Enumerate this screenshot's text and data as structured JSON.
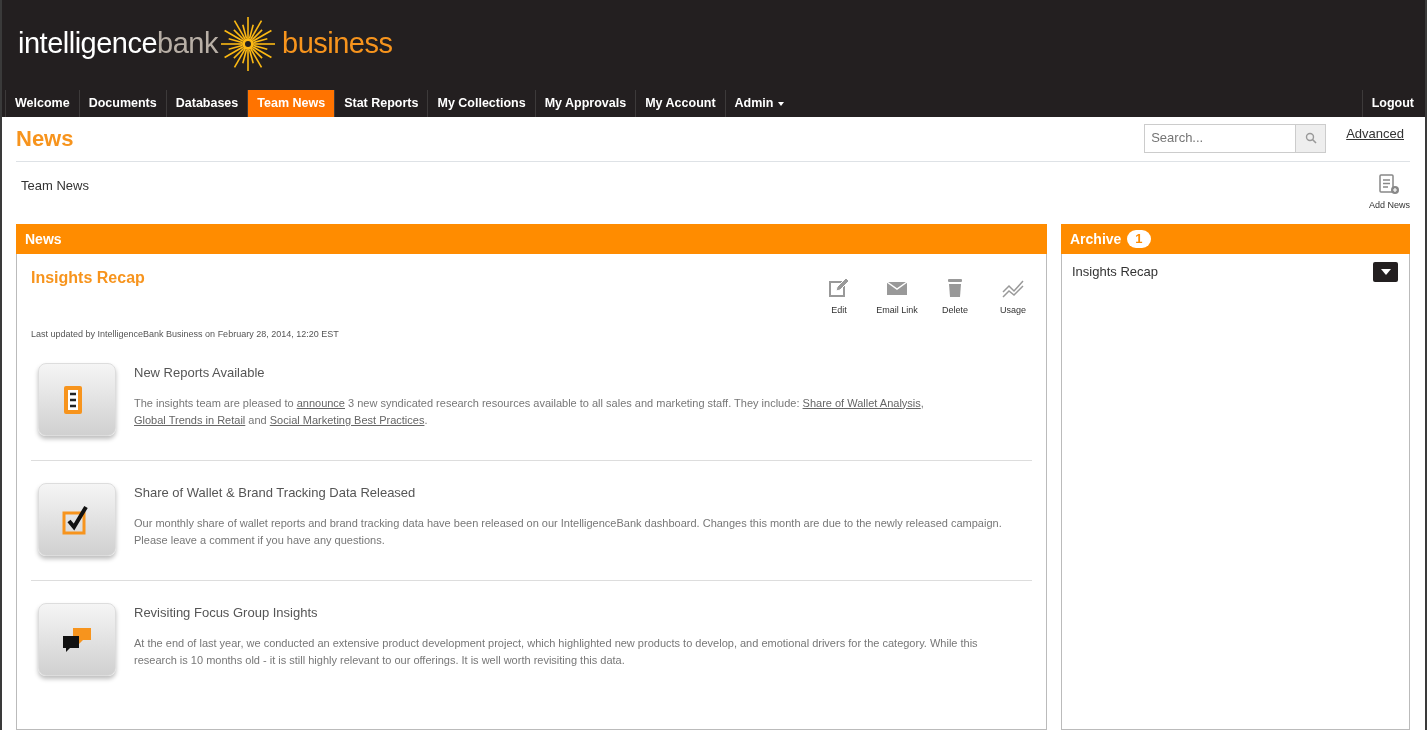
{
  "logo": {
    "part_1": "intelligence",
    "part_2": "bank",
    "part_3": "business"
  },
  "nav": {
    "tabs": [
      {
        "label": "Welcome",
        "selected": false,
        "dropdown": false
      },
      {
        "label": "Documents",
        "selected": false,
        "dropdown": false
      },
      {
        "label": "Databases",
        "selected": false,
        "dropdown": false
      },
      {
        "label": "Team News",
        "selected": true,
        "dropdown": false
      },
      {
        "label": "Stat Reports",
        "selected": false,
        "dropdown": false
      },
      {
        "label": "My Collections",
        "selected": false,
        "dropdown": false
      },
      {
        "label": "My Approvals",
        "selected": false,
        "dropdown": false
      },
      {
        "label": "My Account",
        "selected": false,
        "dropdown": false
      },
      {
        "label": "Admin",
        "selected": false,
        "dropdown": true
      }
    ],
    "logout": "Logout"
  },
  "page": {
    "title": "News",
    "search": {
      "placeholder": "Search..."
    },
    "advanced": "Advanced",
    "breadcrumb": "Team News",
    "add_button": "Add News"
  },
  "news_panel": {
    "header": "News",
    "title": "Insights Recap",
    "actions": [
      {
        "kind": "edit",
        "label": "Edit"
      },
      {
        "kind": "email",
        "label": "Email Link"
      },
      {
        "kind": "delete",
        "label": "Delete"
      },
      {
        "kind": "usage",
        "label": "Usage"
      }
    ],
    "updated": "Last updated by IntelligenceBank Business on February 28, 2014, 12:20 EST",
    "items": [
      {
        "kind": "list",
        "title": "New Reports Available",
        "body": [
          {
            "text": "The insights team are pleased to ",
            "link": false
          },
          {
            "text": "announce",
            "link": true
          },
          {
            "text": " 3 new syndicated research resources available to all sales and marketing staff.  They include:  ",
            "link": false
          },
          {
            "text": "Share of Wallet Analysis",
            "link": true
          },
          {
            "text": ", ",
            "link": false
          },
          {
            "text": "Global Trends in Retail",
            "link": true
          },
          {
            "text": " and ",
            "link": false
          },
          {
            "text": "Social Marketing Best Practices",
            "link": true
          },
          {
            "text": ".",
            "link": false
          }
        ]
      },
      {
        "kind": "check",
        "title": "Share of Wallet & Brand Tracking Data Released",
        "body": [
          {
            "text": "Our monthly share of wallet reports and brand tracking data have been released on our IntelligenceBank dashboard.  Changes this month are due to the newly released campaign.  Please leave a comment if you have any questions.",
            "link": false
          }
        ]
      },
      {
        "kind": "chat",
        "title": "Revisiting Focus Group Insights",
        "body": [
          {
            "text": "At the end of last year, we conducted an extensive product development project, which highlighted new products to develop, and emotional drivers for the category.  While this research is 10 months old - it is still highly relevant to our offerings.  It is well worth revisiting this data.",
            "link": false
          }
        ]
      }
    ]
  },
  "archive_panel": {
    "header": "Archive",
    "count": "1",
    "items": [
      "Insights Recap"
    ]
  }
}
